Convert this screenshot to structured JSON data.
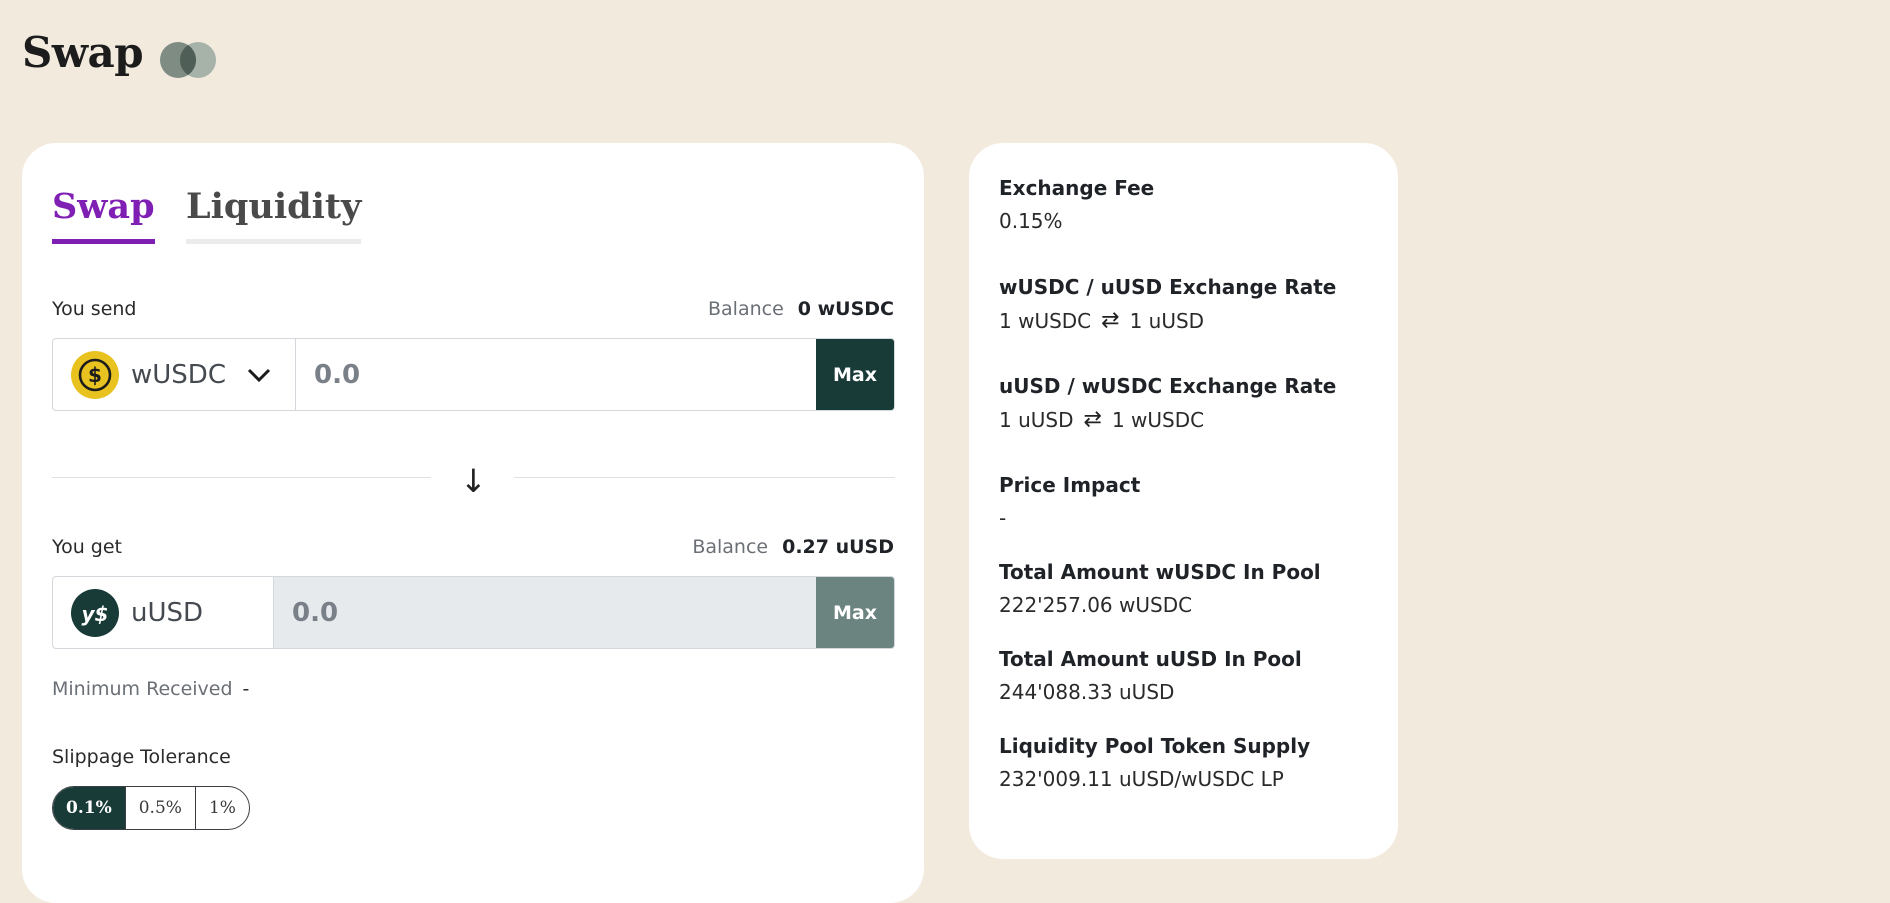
{
  "header": {
    "title": "Swap"
  },
  "tabs": [
    {
      "label": "Swap",
      "active": true
    },
    {
      "label": "Liquidity",
      "active": false
    }
  ],
  "send": {
    "label": "You send",
    "balance_label": "Balance",
    "balance_value": "0 wUSDC",
    "token": "wUSDC",
    "token_icon": "usdc-coin-icon",
    "amount_placeholder": "0.0",
    "max_label": "Max"
  },
  "get": {
    "label": "You get",
    "balance_label": "Balance",
    "balance_value": "0.27 uUSD",
    "token": "uUSD",
    "token_icon": "uusd-coin-icon",
    "amount_placeholder": "0.0",
    "max_label": "Max"
  },
  "minimum_received": {
    "label": "Minimum Received",
    "value": "-"
  },
  "slippage": {
    "label": "Slippage Tolerance",
    "options": [
      "0.1%",
      "0.5%",
      "1%"
    ],
    "selected": "0.1%"
  },
  "info": {
    "exchange_fee": {
      "label": "Exchange Fee",
      "value": "0.15%"
    },
    "rate_wusdc_uusd": {
      "label": "wUSDC / uUSD Exchange Rate",
      "from": "1 wUSDC",
      "to": "1 uUSD"
    },
    "rate_uusd_wusdc": {
      "label": "uUSD / wUSDC Exchange Rate",
      "from": "1 uUSD",
      "to": "1 wUSDC"
    },
    "price_impact": {
      "label": "Price Impact",
      "value": "-"
    },
    "pool_wusdc": {
      "label": "Total Amount wUSDC In Pool",
      "value": "222'257.06 wUSDC"
    },
    "pool_uusd": {
      "label": "Total Amount uUSD In Pool",
      "value": "244'088.33 uUSD"
    },
    "lp_supply": {
      "label": "Liquidity Pool Token Supply",
      "value": "232'009.11 uUSD/wUSDC LP"
    }
  },
  "colors": {
    "background": "#f3eade",
    "accent_purple": "#7f1fb3",
    "dark_green": "#183b38",
    "usdc_gold": "#e8c21f"
  }
}
